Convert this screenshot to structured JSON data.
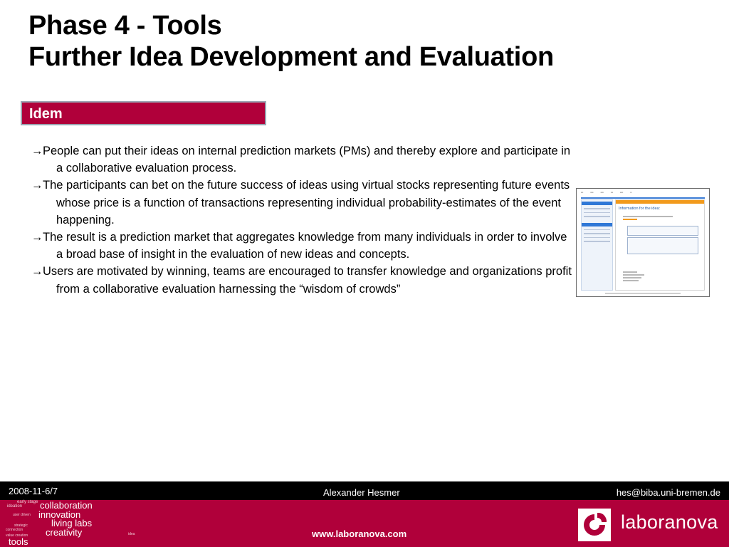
{
  "title": {
    "line1": "Phase 4 - Tools",
    "line2": "Further Idea Development and Evaluation"
  },
  "section": {
    "label": "Idem"
  },
  "bullets": [
    {
      "arrow": "→",
      "text": "People can put their ideas on internal prediction markets (PMs) and thereby explore and participate in a collaborative evaluation process."
    },
    {
      "arrow": "→",
      "text": "The participants can bet on the future success of ideas using virtual stocks representing future events whose price is a function of transactions representing individual probability-estimates of the event happening."
    },
    {
      "arrow": "→",
      "text": "The result is a prediction market that aggregates knowledge from many individuals in order to involve a broad base of insight in the evaluation of new ideas and concepts."
    },
    {
      "arrow": "→",
      "text": "Users are motivated by winning, teams are encouraged to transfer knowledge and organizations profit from a collaborative evaluation harnessing the “wisdom of crowds”"
    }
  ],
  "screenshot": {
    "heading": "Information for the idea:"
  },
  "footer": {
    "date": "2008-11-6/7",
    "author": "Alexander Hesmer",
    "email": "hes@biba.uni-bremen.de",
    "url": "www.laboranova.com",
    "brand": "laboranova",
    "cloud_words": [
      "collaboration",
      "innovation",
      "living labs",
      "creativity",
      "tools",
      "early stage",
      "ideation",
      "user driven",
      "connection",
      "strategic",
      "value creation",
      "idea"
    ]
  },
  "colors": {
    "accent": "#b0003a",
    "footer_black": "#000000"
  }
}
